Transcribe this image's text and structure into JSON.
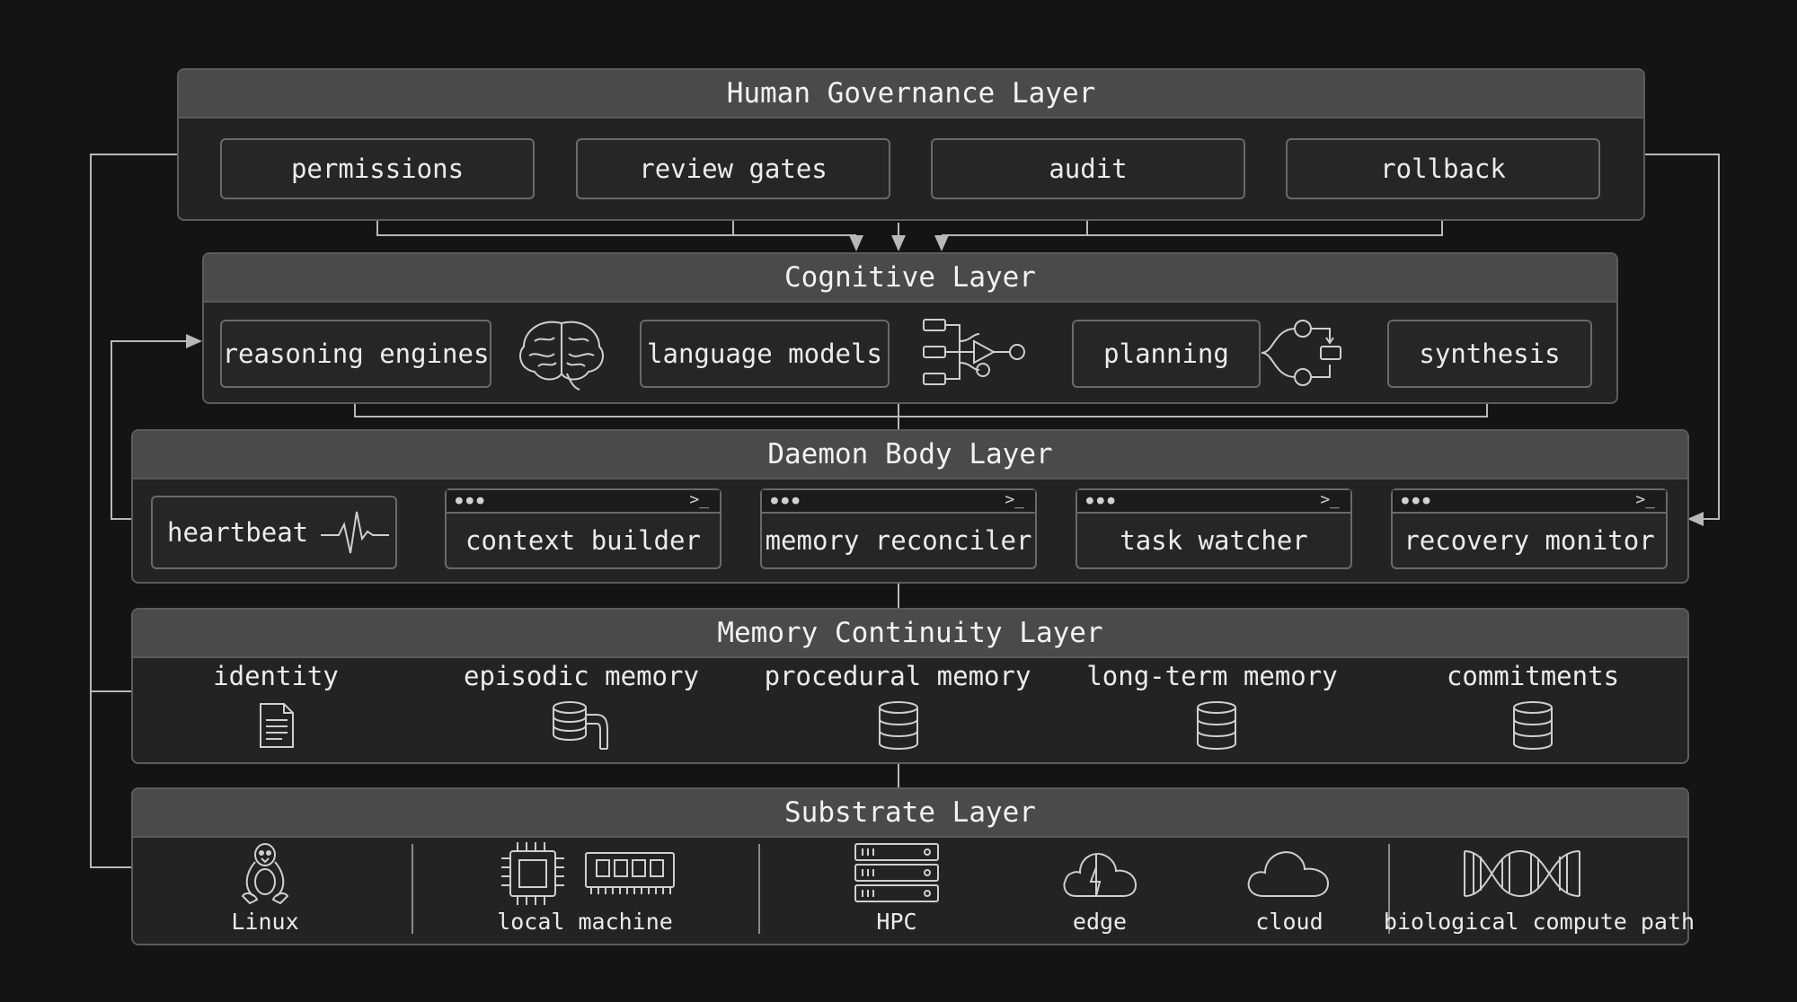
{
  "governance": {
    "title": "Human Governance Layer",
    "items": [
      "permissions",
      "review gates",
      "audit",
      "rollback"
    ]
  },
  "cognitive": {
    "title": "Cognitive Layer",
    "items": [
      "reasoning engines",
      "language models",
      "planning",
      "synthesis"
    ]
  },
  "daemon": {
    "title": "Daemon Body Layer",
    "heartbeat": "heartbeat",
    "terminals": [
      "context builder",
      "memory reconciler",
      "task watcher",
      "recovery monitor"
    ],
    "terminal_prompt": ">_"
  },
  "memory": {
    "title": "Memory Continuity Layer",
    "items": [
      "identity",
      "episodic memory",
      "procedural memory",
      "long-term memory",
      "commitments"
    ]
  },
  "substrate": {
    "title": "Substrate Layer",
    "items": [
      "Linux",
      "local machine",
      "HPC",
      "edge",
      "cloud",
      "biological compute path"
    ]
  },
  "colors": {
    "background": "#141414",
    "panel": "#232323",
    "title_bar": "#4a4a4a",
    "line": "#b8b8b8"
  }
}
